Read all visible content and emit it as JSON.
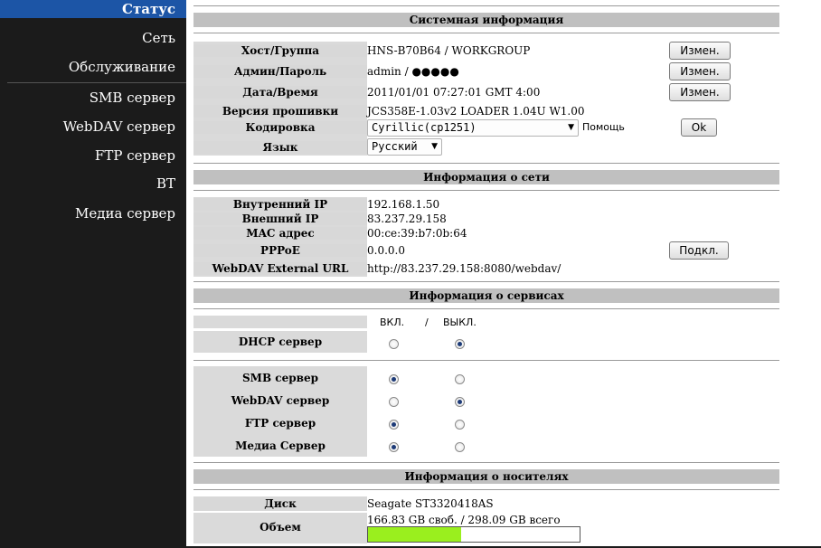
{
  "sidebar": {
    "items": [
      {
        "label": "Статус",
        "active": true
      },
      {
        "label": "Сеть"
      },
      {
        "label": "Обслуживание"
      },
      {
        "label": "SMB сервер"
      },
      {
        "label": "WebDAV сервер"
      },
      {
        "label": "FTP сервер"
      },
      {
        "label": "BT"
      },
      {
        "label": "Медиа сервер"
      }
    ]
  },
  "system": {
    "header": "Системная информация",
    "host_label": "Хост/Группа",
    "host_value": "HNS-B70B64 / WORKGROUP",
    "admin_label": "Админ/Пароль",
    "admin_value": "admin / ●●●●●",
    "date_label": "Дата/Время",
    "date_value": "2011/01/01 07:27:01 GMT 4:00",
    "firmware_label": "Версия прошивки",
    "firmware_value": "JCS358E-1.03v2 LOADER 1.04U W1.00",
    "encoding_label": "Кодировка",
    "encoding_value": "Cyrillic(cp1251)",
    "help_label": "Помощь",
    "language_label": "Язык",
    "language_value": "Русский",
    "change_button": "Измен.",
    "ok_button": "Ok"
  },
  "network": {
    "header": "Информация о сети",
    "internal_ip_label": "Внутренний IP",
    "internal_ip_value": "192.168.1.50",
    "external_ip_label": "Внешний IP",
    "external_ip_value": "83.237.29.158",
    "mac_label": "MAC адрес",
    "mac_value": "00:ce:39:b7:0b:64",
    "pppoe_label": "PPPoE",
    "pppoe_value": "0.0.0.0",
    "webdav_label": "WebDAV External URL",
    "webdav_value": "http://83.237.29.158:8080/webdav/",
    "connect_button": "Подкл."
  },
  "services": {
    "header": "Информация о сервисах",
    "on_label": "ВКЛ.",
    "slash": "/",
    "off_label": "ВЫКЛ.",
    "dhcp": {
      "label": "DHCP сервер",
      "on": false
    },
    "smb": {
      "label": "SMB сервер",
      "on": true
    },
    "webdav": {
      "label": "WebDAV сервер",
      "on": false
    },
    "ftp": {
      "label": "FTP сервер",
      "on": true
    },
    "media": {
      "label": "Медиа Сервер",
      "on": true
    }
  },
  "storage": {
    "header": "Информация о носителях",
    "disk_label": "Диск",
    "disk_value": "Seagate ST3320418AS",
    "volume_label": "Объем",
    "volume_value": "166.83 GB своб. / 298.09 GB всего",
    "used_fraction": 0.44
  },
  "colors": {
    "sidebar_bg": "#1b1b1b",
    "active_item": "#1c55a6",
    "header_bg": "#c0c0c0",
    "label_bg": "#d8d8d8",
    "progress_fill": "#9aef1e"
  }
}
